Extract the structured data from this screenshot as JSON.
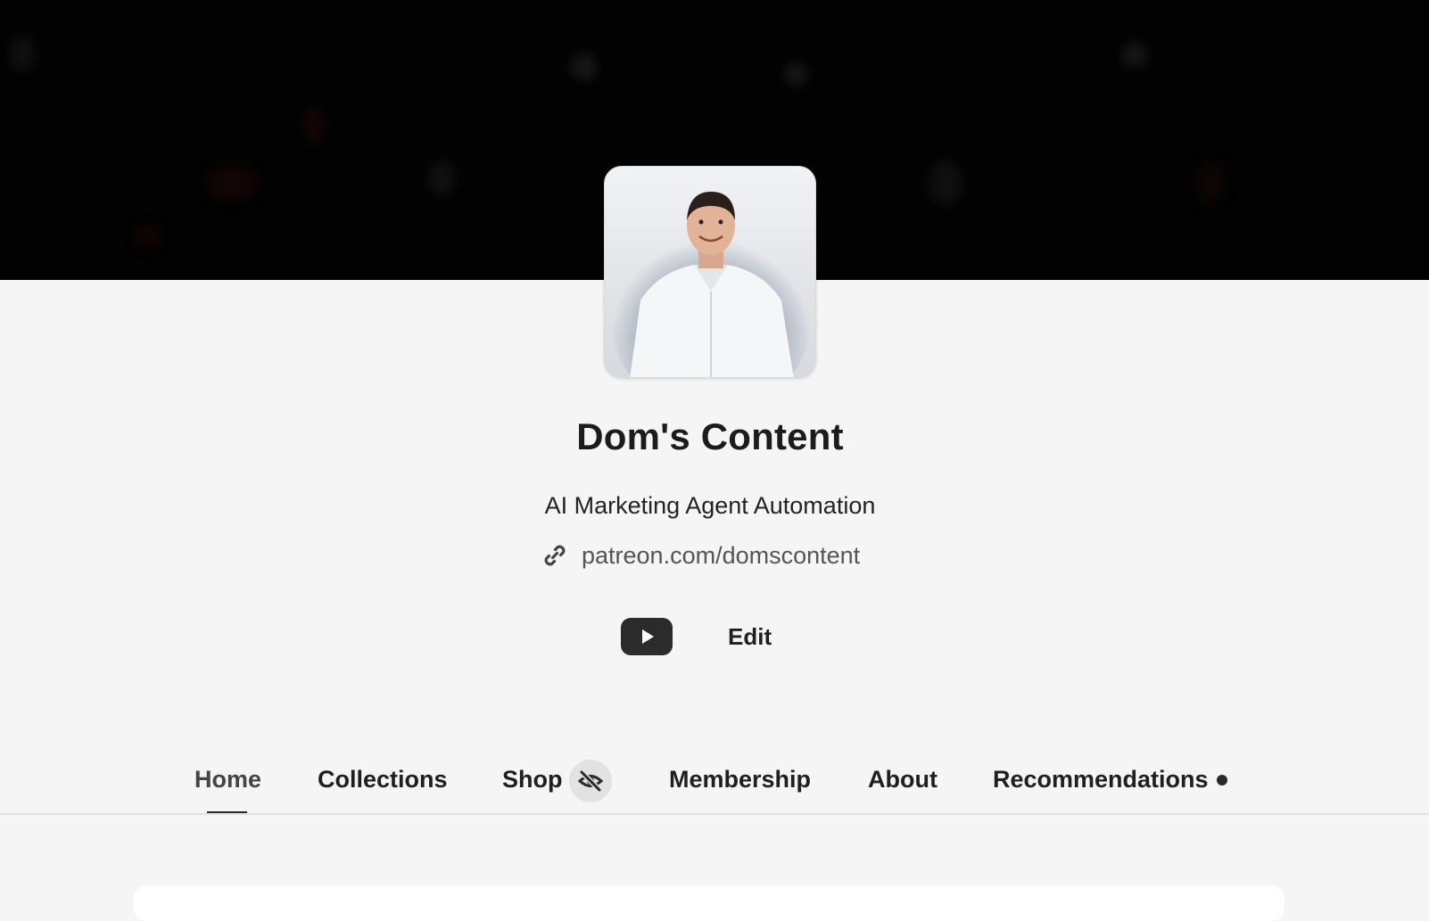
{
  "creator": {
    "name": "Dom's Content",
    "tagline": "AI Marketing Agent Automation",
    "link": "patreon.com/domscontent",
    "link_icon": "link-icon"
  },
  "social": {
    "youtube_icon": "youtube-icon",
    "edit_label": "Edit"
  },
  "tabs": [
    {
      "label": "Home",
      "active": true
    },
    {
      "label": "Collections"
    },
    {
      "label": "Shop",
      "badge_icon": "eye-off-icon"
    },
    {
      "label": "Membership"
    },
    {
      "label": "About"
    },
    {
      "label": "Recommendations",
      "indicator": "dot"
    }
  ],
  "colors": {
    "banner": "#020202",
    "page_background": "#f5f5f5",
    "text": "#1f1f1f",
    "muted_text": "#555555"
  }
}
